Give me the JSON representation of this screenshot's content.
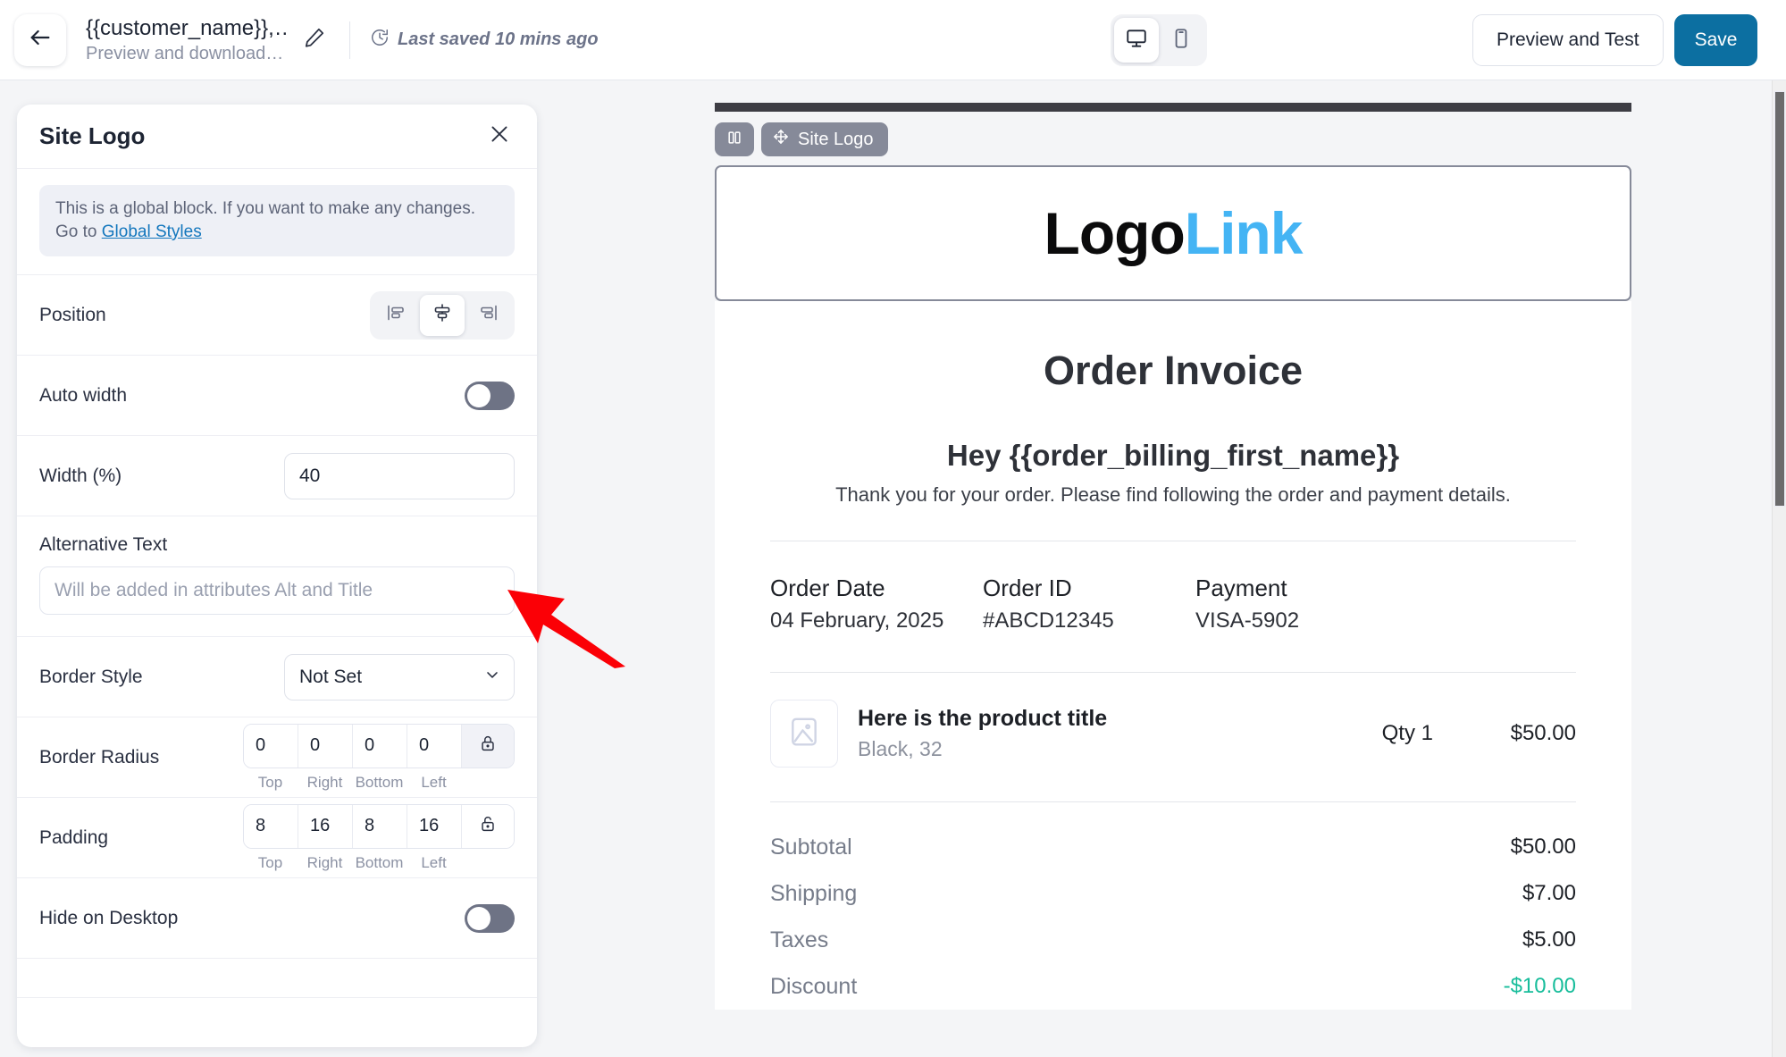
{
  "topbar": {
    "back_icon": "arrow-left-icon",
    "title": "{{customer_name}},…",
    "subtitle": "Preview and download…",
    "edit_icon": "pencil-icon",
    "saved_icon": "clock-icon",
    "saved_text": "Last saved 10 mins ago",
    "device_desktop_icon": "desktop-icon",
    "device_mobile_icon": "mobile-icon",
    "preview_label": "Preview and Test",
    "save_label": "Save",
    "save_color": "#0c6fa1"
  },
  "panel": {
    "title": "Site Logo",
    "close_icon": "close-icon",
    "notice_text": "This is a global block. If you want to make any changes. Go to ",
    "notice_link": "Global Styles",
    "position": {
      "label": "Position",
      "options": [
        "align-left-icon",
        "align-center-icon",
        "align-right-icon"
      ],
      "selected_index": 1
    },
    "auto_width": {
      "label": "Auto width",
      "value": "off"
    },
    "width": {
      "label": "Width (%)",
      "value": "40"
    },
    "alt_text": {
      "label": "Alternative Text",
      "value": "",
      "placeholder": "Will be added in attributes Alt and Title"
    },
    "border_style": {
      "label": "Border Style",
      "value": "Not Set",
      "chevron_icon": "chevron-down-icon"
    },
    "border_radius": {
      "label": "Border Radius",
      "values": [
        "0",
        "0",
        "0",
        "0"
      ],
      "sides": [
        "Top",
        "Right",
        "Bottom",
        "Left"
      ],
      "lock_icon": "lock-closed-icon",
      "locked": true
    },
    "padding": {
      "label": "Padding",
      "values": [
        "8",
        "16",
        "8",
        "16"
      ],
      "sides": [
        "Top",
        "Right",
        "Bottom",
        "Left"
      ],
      "lock_icon": "lock-open-icon",
      "locked": false
    },
    "hide_on_desktop": {
      "label": "Hide on Desktop",
      "value": "off"
    }
  },
  "canvas": {
    "block_columns_icon": "columns-icon",
    "block_move_icon": "move-icon",
    "block_label": "Site Logo",
    "logo": {
      "part1": "Logo",
      "part2": "Link",
      "color1": "#0b0b0c",
      "color2": "#44b4f4"
    },
    "invoice": {
      "title": "Order Invoice",
      "greeting": "Hey {{order_billing_first_name}}",
      "thanks": "Thank you for your order. Please find following the order and payment details.",
      "meta": [
        {
          "label": "Order Date",
          "value": "04 February, 2025"
        },
        {
          "label": "Order ID",
          "value": "#ABCD12345"
        },
        {
          "label": "Payment",
          "value": "VISA-5902"
        }
      ],
      "line_item": {
        "thumb_icon": "image-placeholder-icon",
        "title": "Here is the product title",
        "variant": "Black, 32",
        "qty": "Qty 1",
        "price": "$50.00"
      },
      "totals": [
        {
          "label": "Subtotal",
          "value": "$50.00",
          "accent": false
        },
        {
          "label": "Shipping",
          "value": "$7.00",
          "accent": false
        },
        {
          "label": "Taxes",
          "value": "$5.00",
          "accent": false
        },
        {
          "label": "Discount",
          "value": "-$10.00",
          "accent": true
        }
      ],
      "discount_color": "#18bd9b"
    }
  },
  "annotation": {
    "arrow_icon": "red-arrow-icon",
    "color": "#fb0006"
  },
  "scrollbar": {
    "name": "vertical-scrollbar"
  }
}
